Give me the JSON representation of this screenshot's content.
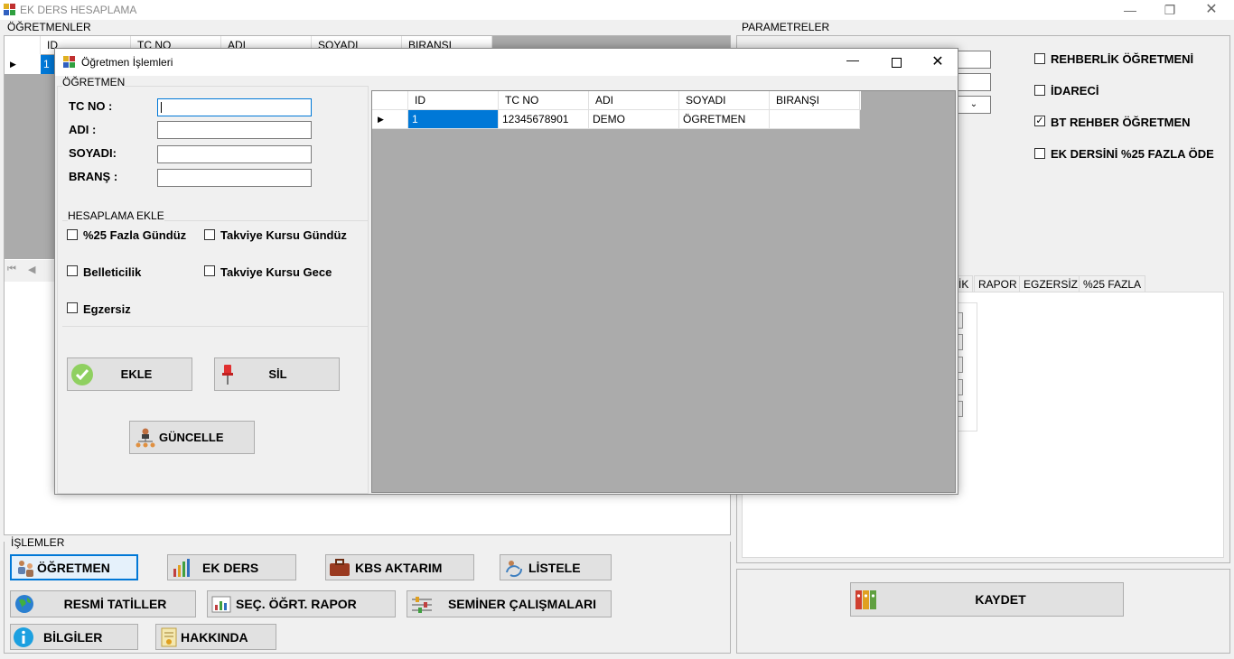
{
  "app": {
    "title": "EK DERS HESAPLAMA"
  },
  "main": {
    "teachers_group": "ÖĞRETMENLER",
    "columns": [
      "ID",
      "TC NO",
      "ADI",
      "SOYADI",
      "BIRANŞI"
    ],
    "selected_row_id": "1",
    "params_group": "PARAMETRELER",
    "params_checkboxes": [
      {
        "label": "REHBERLİK ÖĞRETMENİ",
        "checked": false
      },
      {
        "label": "İDARECİ",
        "checked": false
      },
      {
        "label": "BT REHBER ÖĞRETMEN",
        "checked": true
      },
      {
        "label": "EK DERSİNİ %25 FAZLA ÖDE",
        "checked": false
      }
    ],
    "tabs": [
      "İK",
      "RAPOR",
      "EGZERSİZ",
      "%25 FAZLA"
    ],
    "save_button": "KAYDET",
    "operations_group": "İŞLEMLER",
    "buttons": {
      "teacher": "ÖĞRETMEN",
      "ek_ders": "EK DERS",
      "kbs": "KBS AKTARIM",
      "list": "LİSTELE",
      "holidays": "RESMİ TATİLLER",
      "election_report": "SEÇ. ÖĞRT. RAPOR",
      "seminar": "SEMİNER ÇALIŞMALARI",
      "info": "BİLGİLER",
      "about": "HAKKINDA"
    }
  },
  "dialog": {
    "title": "Öğretmen İşlemleri",
    "group": "ÖĞRETMEN",
    "fields": {
      "tc": "TC NO :",
      "name": "ADI :",
      "surname": "SOYADI:",
      "branch": "BRANŞ :"
    },
    "calc_group": "HESAPLAMA EKLE",
    "checkboxes": {
      "fazla_gunduz": "%25 Fazla Gündüz",
      "takviye_gunduz": "Takviye Kursu Gündüz",
      "belleticilik": "Belleticilik",
      "takviye_gece": "Takviye Kursu Gece",
      "egzersiz": "Egzersiz"
    },
    "buttons": {
      "add": "EKLE",
      "delete": "SİL",
      "update": "GÜNCELLE"
    },
    "grid_columns": [
      "ID",
      "TC NO",
      "ADI",
      "SOYADI",
      "BIRANŞI"
    ],
    "grid_row": {
      "id": "1",
      "tc": "12345678901",
      "name": "DEMO",
      "surname": "ÖGRETMEN",
      "branch": ""
    }
  }
}
